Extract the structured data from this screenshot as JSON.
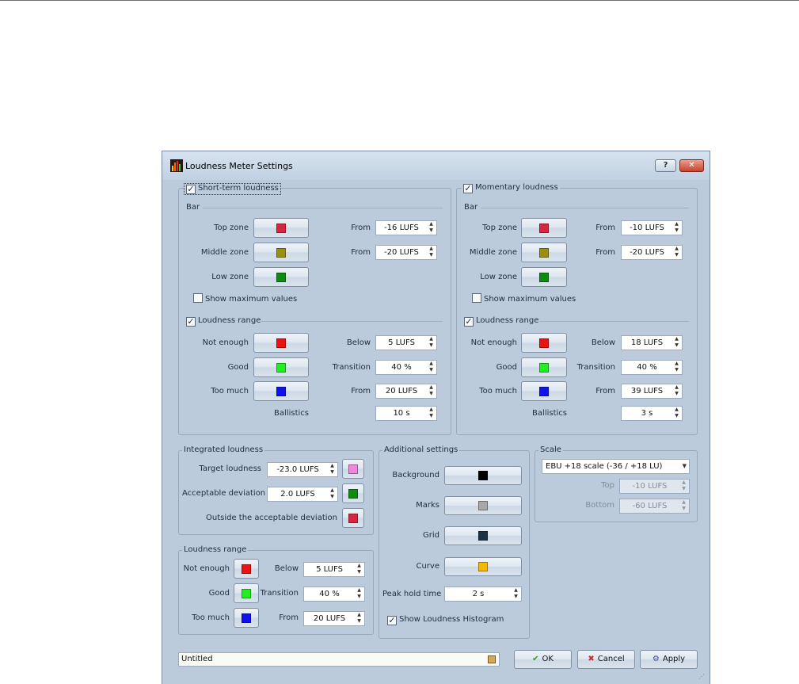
{
  "dialog": {
    "title": "Loudness Meter Settings",
    "help_label": "?",
    "close_label": "✕"
  },
  "short_term": {
    "title": "Short-term loudness",
    "checked": true,
    "bar": {
      "title": "Bar",
      "top_zone": {
        "label": "Top zone",
        "color": "#d8263f",
        "from_label": "From",
        "from_value": "-16 LUFS"
      },
      "middle_zone": {
        "label": "Middle zone",
        "color": "#9a8f13",
        "from_label": "From",
        "from_value": "-20 LUFS"
      },
      "low_zone": {
        "label": "Low zone",
        "color": "#118a11"
      },
      "show_max": {
        "label": "Show maximum values",
        "checked": false
      }
    },
    "range": {
      "title": "Loudness range",
      "checked": true,
      "not_enough": {
        "label": "Not enough",
        "color": "#ee1111",
        "cond_label": "Below",
        "value": "5 LUFS"
      },
      "good": {
        "label": "Good",
        "color": "#22ee22",
        "cond_label": "Transition",
        "value": "40 %"
      },
      "too_much": {
        "label": "Too much",
        "color": "#1111ee",
        "cond_label": "From",
        "value": "20 LUFS"
      },
      "ballistics": {
        "label": "Ballistics",
        "value": "10 s"
      }
    }
  },
  "momentary": {
    "title": "Momentary loudness",
    "checked": true,
    "bar": {
      "title": "Bar",
      "top_zone": {
        "label": "Top zone",
        "color": "#d8263f",
        "from_label": "From",
        "from_value": "-10 LUFS"
      },
      "middle_zone": {
        "label": "Middle zone",
        "color": "#9a8f13",
        "from_label": "From",
        "from_value": "-20 LUFS"
      },
      "low_zone": {
        "label": "Low zone",
        "color": "#118a11"
      },
      "show_max": {
        "label": "Show maximum values",
        "checked": false
      }
    },
    "range": {
      "title": "Loudness range",
      "checked": true,
      "not_enough": {
        "label": "Not enough",
        "color": "#ee1111",
        "cond_label": "Below",
        "value": "18 LUFS"
      },
      "good": {
        "label": "Good",
        "color": "#22ee22",
        "cond_label": "Transition",
        "value": "40 %"
      },
      "too_much": {
        "label": "Too much",
        "color": "#1111ee",
        "cond_label": "From",
        "value": "39 LUFS"
      },
      "ballistics": {
        "label": "Ballistics",
        "value": "3 s"
      }
    }
  },
  "integrated": {
    "title": "Integrated loudness",
    "target": {
      "label": "Target loudness",
      "value": "-23.0 LUFS",
      "color": "#ee88dd"
    },
    "deviation": {
      "label": "Acceptable deviation",
      "value": "2.0 LUFS",
      "color": "#118a11"
    },
    "outside": {
      "label": "Outside the acceptable deviation",
      "color": "#d8263f"
    }
  },
  "loudness_range": {
    "title": "Loudness range",
    "not_enough": {
      "label": "Not enough",
      "color": "#ee1111",
      "cond_label": "Below",
      "value": "5 LUFS"
    },
    "good": {
      "label": "Good",
      "color": "#22ee22",
      "cond_label": "Transition",
      "value": "40 %"
    },
    "too_much": {
      "label": "Too much",
      "color": "#1111ee",
      "cond_label": "From",
      "value": "20 LUFS"
    }
  },
  "additional": {
    "title": "Additional settings",
    "background": {
      "label": "Background",
      "color": "#000000"
    },
    "marks": {
      "label": "Marks",
      "color": "#a8a8a8"
    },
    "grid": {
      "label": "Grid",
      "color": "#1e3246"
    },
    "curve": {
      "label": "Curve",
      "color": "#f5b800"
    },
    "peak_hold": {
      "label": "Peak hold time",
      "value": "2 s"
    },
    "histogram": {
      "label": "Show Loudness Histogram",
      "checked": true
    }
  },
  "scale": {
    "title": "Scale",
    "selected": "EBU +18 scale (-36 / +18 LU)",
    "top": {
      "label": "Top",
      "value": "-10 LUFS"
    },
    "bottom": {
      "label": "Bottom",
      "value": "-60 LUFS"
    }
  },
  "footer": {
    "preset_name": "Untitled",
    "ok_label": "OK",
    "cancel_label": "Cancel",
    "apply_label": "Apply"
  }
}
